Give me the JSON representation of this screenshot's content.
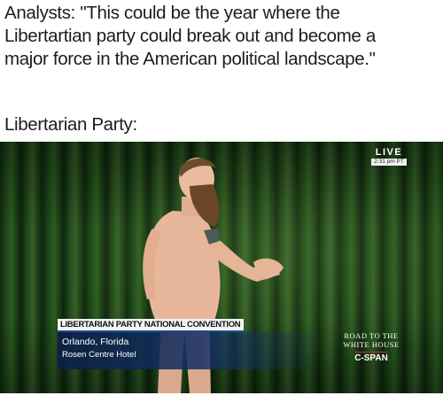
{
  "meme": {
    "caption_lines": [
      "Analysts: \"This could be the year where the",
      "Libertartian party could break out and become a",
      "major force in the American political landscape.\""
    ],
    "subcaption": "Libertarian Party:"
  },
  "broadcast": {
    "live_label": "LIVE",
    "live_time": "2:31 pm PT",
    "lower_third": {
      "headline": "LIBERTARIAN PARTY NATIONAL CONVENTION",
      "location": "Orlando, Florida",
      "venue": "Rosen Centre Hotel"
    },
    "program": {
      "line1": "ROAD TO THE",
      "line2": "WHITE HOUSE",
      "network": "C-SPAN"
    }
  },
  "colors": {
    "curtain": "#1d4418",
    "lower_third_bar": "#142f64",
    "lower_third_header": "#f4f4f4",
    "accent_rule": "#1f4d8f"
  }
}
